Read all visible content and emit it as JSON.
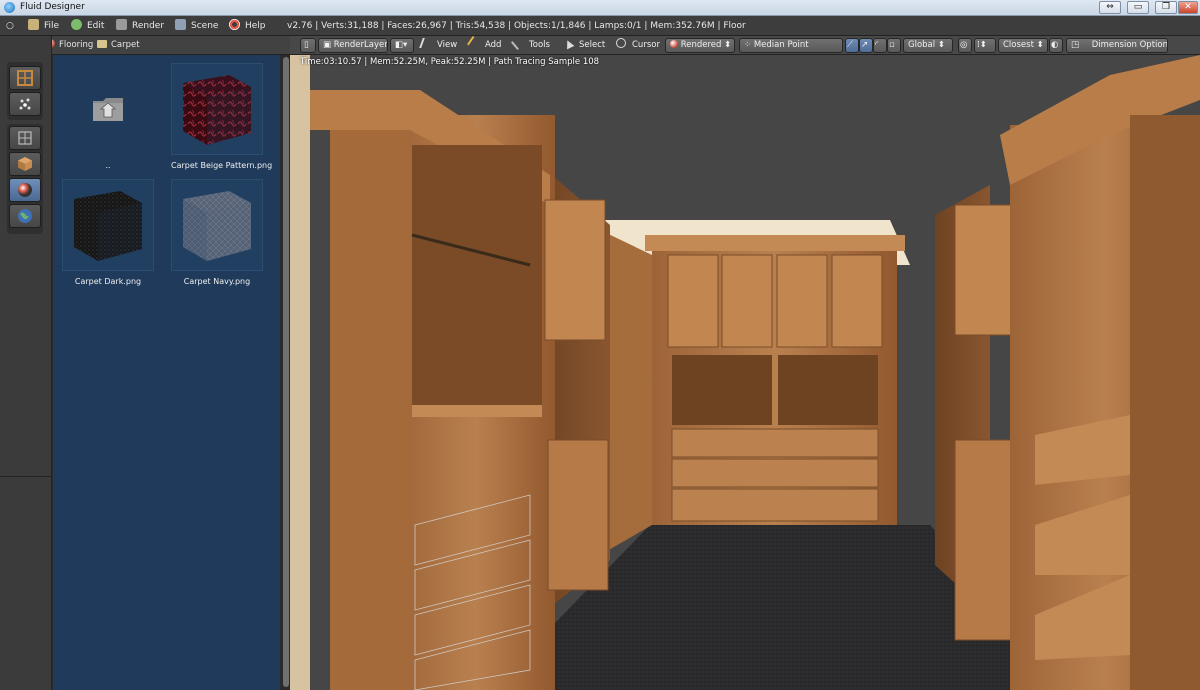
{
  "window": {
    "title": "Fluid Designer"
  },
  "info_header": {
    "menus": [
      "File",
      "Edit",
      "Render",
      "Scene",
      "Help"
    ],
    "stats": "v2.76 | Verts:31,188 | Faces:26,967 | Tris:54,538 | Objects:1/1,846 | Lamps:0/1 | Mem:352.76M | Floor"
  },
  "file_browser": {
    "breadcrumb": [
      "Flooring",
      "Carpet"
    ],
    "items": [
      {
        "label": "..",
        "icon": "parent-folder-icon"
      },
      {
        "label": "Carpet Beige Pattern.png",
        "icon": "carpet-beige-thumbnail"
      },
      {
        "label": "Carpet Dark.png",
        "icon": "carpet-dark-thumbnail"
      },
      {
        "label": "Carpet Navy.png",
        "icon": "carpet-navy-thumbnail"
      }
    ]
  },
  "view_header": {
    "render_layer": "RenderLayer",
    "menus": [
      "View",
      "Add",
      "Tools",
      "Select",
      "Cursor"
    ],
    "shading": "Rendered",
    "pivot": "Median Point",
    "orientation": "Global",
    "snap": "Closest",
    "dimension_options": "Dimension Options"
  },
  "viewport": {
    "render_info": "Time:03:10.57 | Mem:52.25M, Peak:52.25M | Path Tracing Sample 108"
  },
  "colors": {
    "browser_bg": "#1f3a5a",
    "wood": "#b0764a",
    "carpet": "#2a2a2c",
    "accent": "#5a7aa6"
  }
}
